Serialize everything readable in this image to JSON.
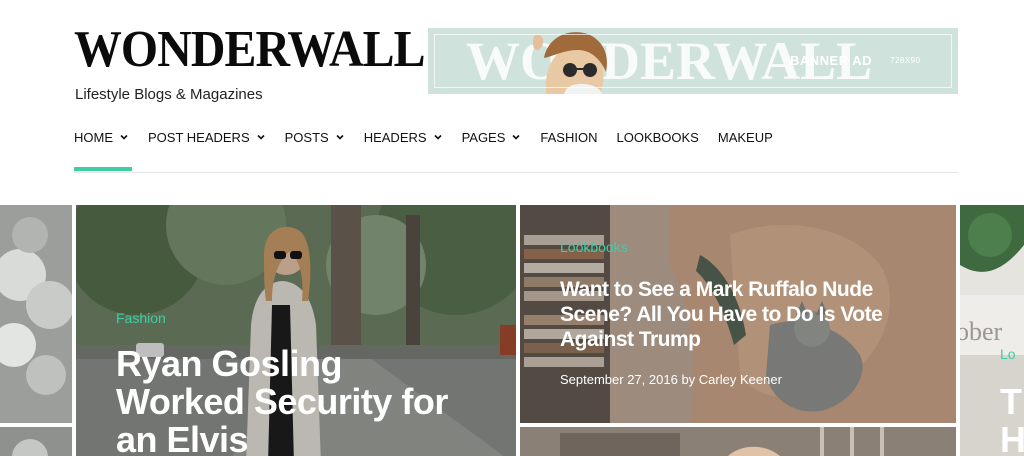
{
  "site": {
    "logo": "WONDERWALL",
    "tagline": "Lifestyle Blogs & Magazines"
  },
  "banner": {
    "brand_word": "WONDERWALL",
    "label": "BANNER AD",
    "size": "728X90",
    "background": "#cfe3dc"
  },
  "nav": {
    "items": [
      {
        "label": "HOME",
        "has_dropdown": true,
        "active": true
      },
      {
        "label": "POST HEADERS",
        "has_dropdown": true
      },
      {
        "label": "POSTS",
        "has_dropdown": true
      },
      {
        "label": "HEADERS",
        "has_dropdown": true
      },
      {
        "label": "PAGES",
        "has_dropdown": true
      },
      {
        "label": "FASHION",
        "has_dropdown": false
      },
      {
        "label": "LOOKBOOKS",
        "has_dropdown": false
      },
      {
        "label": "MAKEUP",
        "has_dropdown": false
      }
    ],
    "accent": "#3ccfa5"
  },
  "slider": {
    "main": {
      "category": "Fashion",
      "title_lines": [
        "Ryan Gosling",
        "Worked Security for",
        "an Elvis"
      ]
    },
    "right_top": {
      "category": "Lookbooks",
      "title_lines": [
        "Want to See a Mark Ruffalo Nude",
        "Scene? All You Have to Do Is Vote",
        "Against Trump"
      ],
      "date": "September 27, 2016",
      "by": "by",
      "author": "Carley Keener"
    },
    "edge_right": {
      "fragment": "ober",
      "category_fragment": "Lo",
      "title_fragment": [
        "T",
        "H"
      ]
    }
  }
}
